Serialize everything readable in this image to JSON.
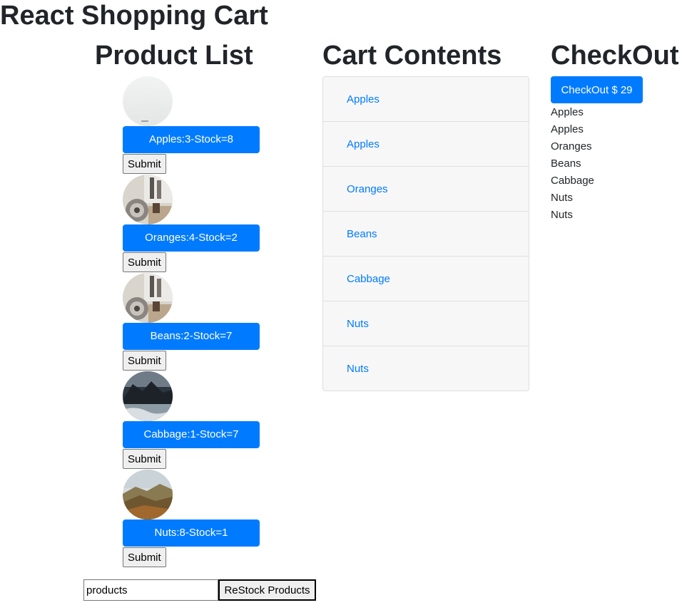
{
  "app_title": "React Shopping Cart",
  "headings": {
    "products": "Product List",
    "cart": "Cart Contents",
    "checkout": "CheckOut"
  },
  "products": [
    {
      "label": "Apples:3-Stock=8",
      "submit": "Submit",
      "image": "fog-photo"
    },
    {
      "label": "Oranges:4-Stock=2",
      "submit": "Submit",
      "image": "speaker-photo"
    },
    {
      "label": "Beans:2-Stock=7",
      "submit": "Submit",
      "image": "speaker-photo"
    },
    {
      "label": "Cabbage:1-Stock=7",
      "submit": "Submit",
      "image": "coast-photo"
    },
    {
      "label": "Nuts:8-Stock=1",
      "submit": "Submit",
      "image": "mountain-photo"
    }
  ],
  "cart": [
    "Apples",
    "Apples",
    "Oranges",
    "Beans",
    "Cabbage",
    "Nuts",
    "Nuts"
  ],
  "checkout": {
    "button": "CheckOut $ 29",
    "items": [
      "Apples",
      "Apples",
      "Oranges",
      "Beans",
      "Cabbage",
      "Nuts",
      "Nuts"
    ]
  },
  "restock": {
    "input_value": "products",
    "button": "ReStock Products"
  },
  "colors": {
    "primary": "#007bff",
    "text": "#212529",
    "cart_bg": "#f7f7f7"
  }
}
